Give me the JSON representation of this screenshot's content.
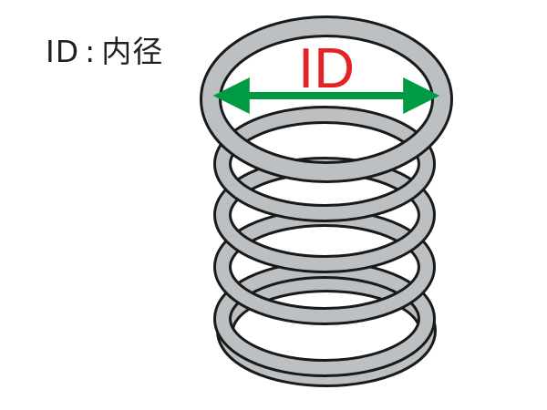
{
  "legend": {
    "term": "ID",
    "separator": ":",
    "definition": "内径"
  },
  "diagram": {
    "dimension_label": "ID",
    "colors": {
      "coil_fill": "#bcc0c2",
      "coil_outline": "#1a1a1a",
      "arrow": "#009944",
      "label": "#e42327"
    },
    "icons": {
      "spring": "coil-spring-icon",
      "arrow": "double-headed-arrow-icon"
    }
  }
}
